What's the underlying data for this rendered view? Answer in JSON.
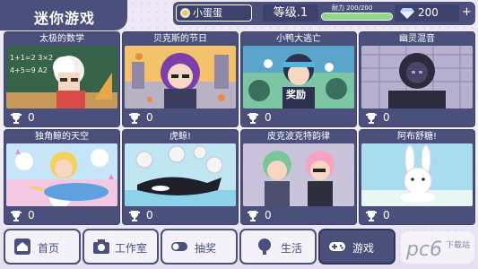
{
  "header": {
    "title": "迷你游戏",
    "profile_name": "小蛋蛋",
    "level": "等级.1",
    "energy_label": "耐力 200/200",
    "energy_fraction": 1.0,
    "gems": "200",
    "plus": "+"
  },
  "games": [
    {
      "title": "太极的数学",
      "score": "0",
      "art": "math"
    },
    {
      "title": "贝克斯的节日",
      "score": "0",
      "art": "festival"
    },
    {
      "title": "小鸭大逃亡",
      "score": "0",
      "art": "duck",
      "overlay": "奖励"
    },
    {
      "title": "幽灵混音",
      "score": "0",
      "art": "ghost"
    },
    {
      "title": "独角鲸的天空",
      "score": "0",
      "art": "narwhal"
    },
    {
      "title": "虎鲸!",
      "score": "0",
      "art": "orca"
    },
    {
      "title": "皮克波克特韵律",
      "score": "0",
      "art": "rhythm"
    },
    {
      "title": "阿布舒糖!",
      "score": "0",
      "art": "bunny"
    }
  ],
  "nav": [
    {
      "label": "首页",
      "icon": "home-icon"
    },
    {
      "label": "工作室",
      "icon": "camera-icon"
    },
    {
      "label": "抽奖",
      "icon": "toggle-icon"
    },
    {
      "label": "生活",
      "icon": "tree-icon"
    },
    {
      "label": "游戏",
      "icon": "gamepad-icon"
    }
  ],
  "watermark": {
    "brand": "pc6",
    "sub": "下载站"
  },
  "colors": {
    "panel": "#4a4f7c",
    "accent": "#8fd88a",
    "background": "#ece8f5"
  }
}
